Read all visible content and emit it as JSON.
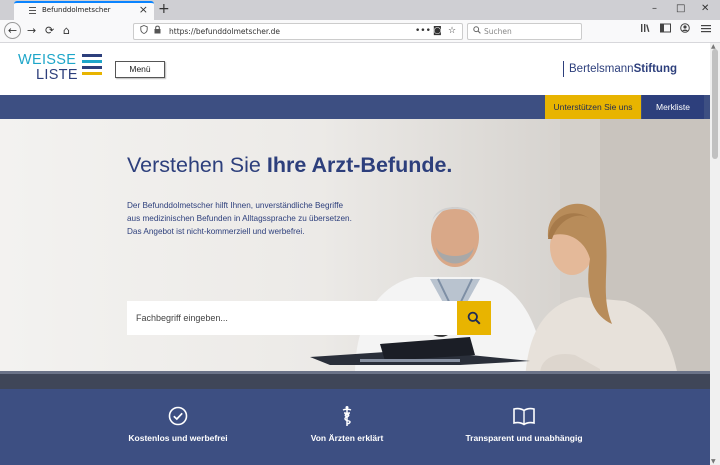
{
  "browser": {
    "tab_title": "Befunddolmetscher",
    "tab_close": "×",
    "new_tab": "+",
    "url": "https://befunddolmetscher.de",
    "search_placeholder": "Suchen",
    "win_min": "–",
    "win_max": "□",
    "win_close": "✕",
    "back": "←",
    "forward": "→",
    "reload": "⟳",
    "home": "⌂",
    "more": "•••",
    "star": "☆",
    "pocket": "◙"
  },
  "header": {
    "logo_line1": "WEISSE",
    "logo_line2": "LISTE",
    "menu_label": "Menü",
    "brand_regular": "Bertelsmann",
    "brand_bold": "Stiftung",
    "logo_colors": [
      "#2d3f7c",
      "#1ea6c9",
      "#2d3f7c",
      "#e8b400"
    ]
  },
  "nav": {
    "support_label": "Unterstützen Sie uns",
    "watchlist_label": "Merkliste"
  },
  "hero": {
    "title_regular": "Verstehen Sie ",
    "title_bold": "Ihre Arzt-Befunde.",
    "description": "Der Befunddolmetscher hilft Ihnen, unverständliche Begriffe aus medizinischen Befunden in Alltagssprache zu übersetzen. Das Angebot ist nicht-kommerziell und werbefrei.",
    "search_placeholder": "Fachbegriff eingeben..."
  },
  "features": [
    {
      "label": "Kostenlos und werbefrei",
      "icon": "check-circle-icon"
    },
    {
      "label": "Von Ärzten erklärt",
      "icon": "caduceus-icon"
    },
    {
      "label": "Transparent und unabhängig",
      "icon": "open-book-icon"
    }
  ],
  "colors": {
    "navy": "#2d3f7c",
    "accent_yellow": "#e8b400",
    "bar_blue": "#3d4f82",
    "logo_cyan": "#1ea6c9"
  }
}
